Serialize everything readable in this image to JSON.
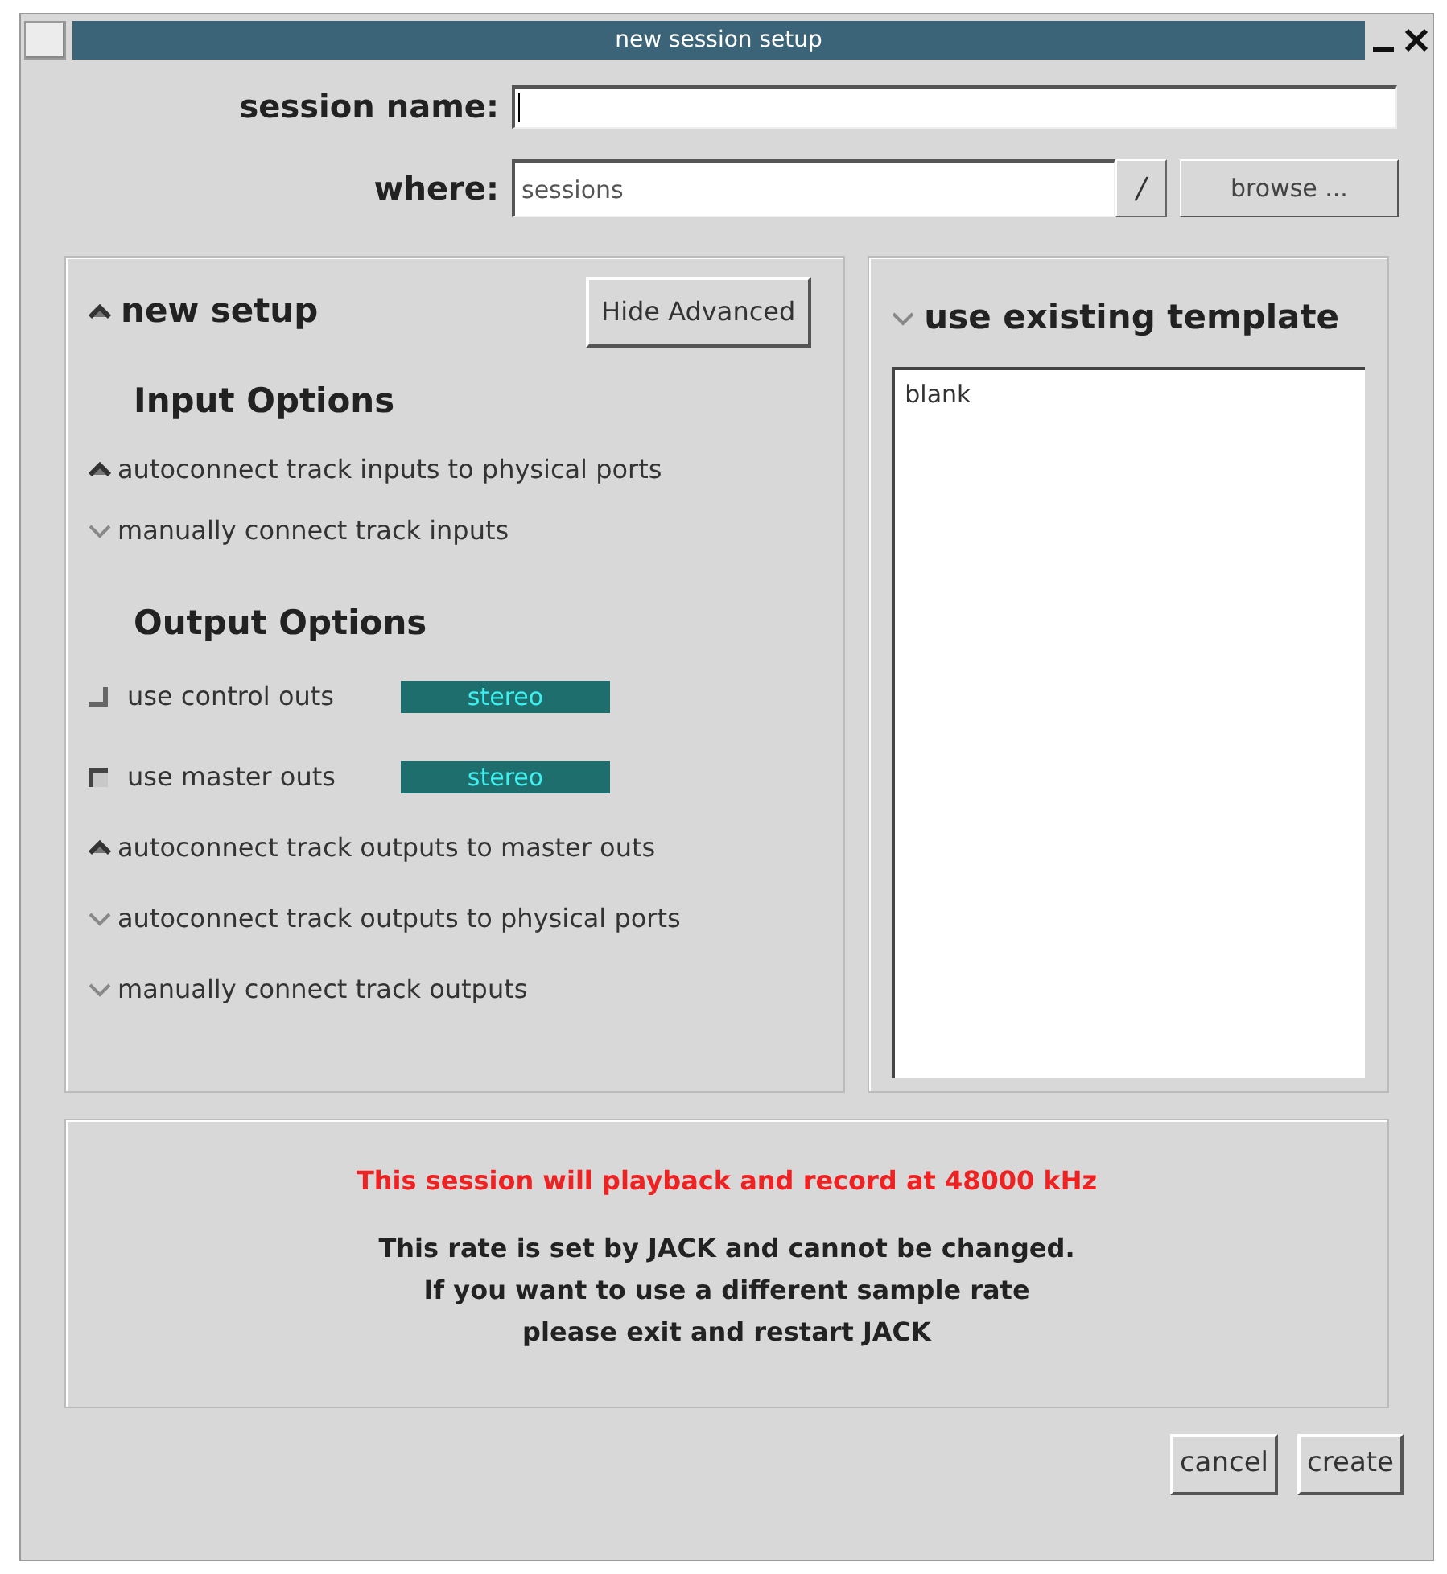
{
  "window": {
    "title": "new session setup"
  },
  "session_name": {
    "label": "session name:"
  },
  "where": {
    "label": "where:",
    "value": "sessions",
    "path_button": "/",
    "browse_button": "browse ..."
  },
  "new_setup": {
    "label": "new setup",
    "selected": true,
    "hide_button": "Hide Advanced",
    "input_options": {
      "heading": "Input Options",
      "options": [
        {
          "label": "autoconnect track inputs to physical ports",
          "selected": true
        },
        {
          "label": "manually connect track inputs",
          "selected": false
        }
      ]
    },
    "output_options": {
      "heading": "Output Options",
      "outs": [
        {
          "label": "use control outs",
          "checked": false,
          "mode": "stereo"
        },
        {
          "label": "use master outs",
          "checked": true,
          "mode": "stereo"
        }
      ],
      "options": [
        {
          "label": "autoconnect track outputs to master outs",
          "selected": true
        },
        {
          "label": "autoconnect track outputs to physical ports",
          "selected": false
        },
        {
          "label": "manually connect track outputs",
          "selected": false
        }
      ]
    }
  },
  "template": {
    "label": "use existing template",
    "selected": false,
    "items": [
      {
        "label": "blank",
        "selected": false
      }
    ]
  },
  "notice": {
    "warning": "This session will playback and record at 48000 kHz",
    "lines": [
      "This rate is set by JACK and cannot be changed.",
      "If you want to use a different sample rate",
      "please exit and restart JACK"
    ]
  },
  "buttons": [
    "cancel",
    "create"
  ]
}
